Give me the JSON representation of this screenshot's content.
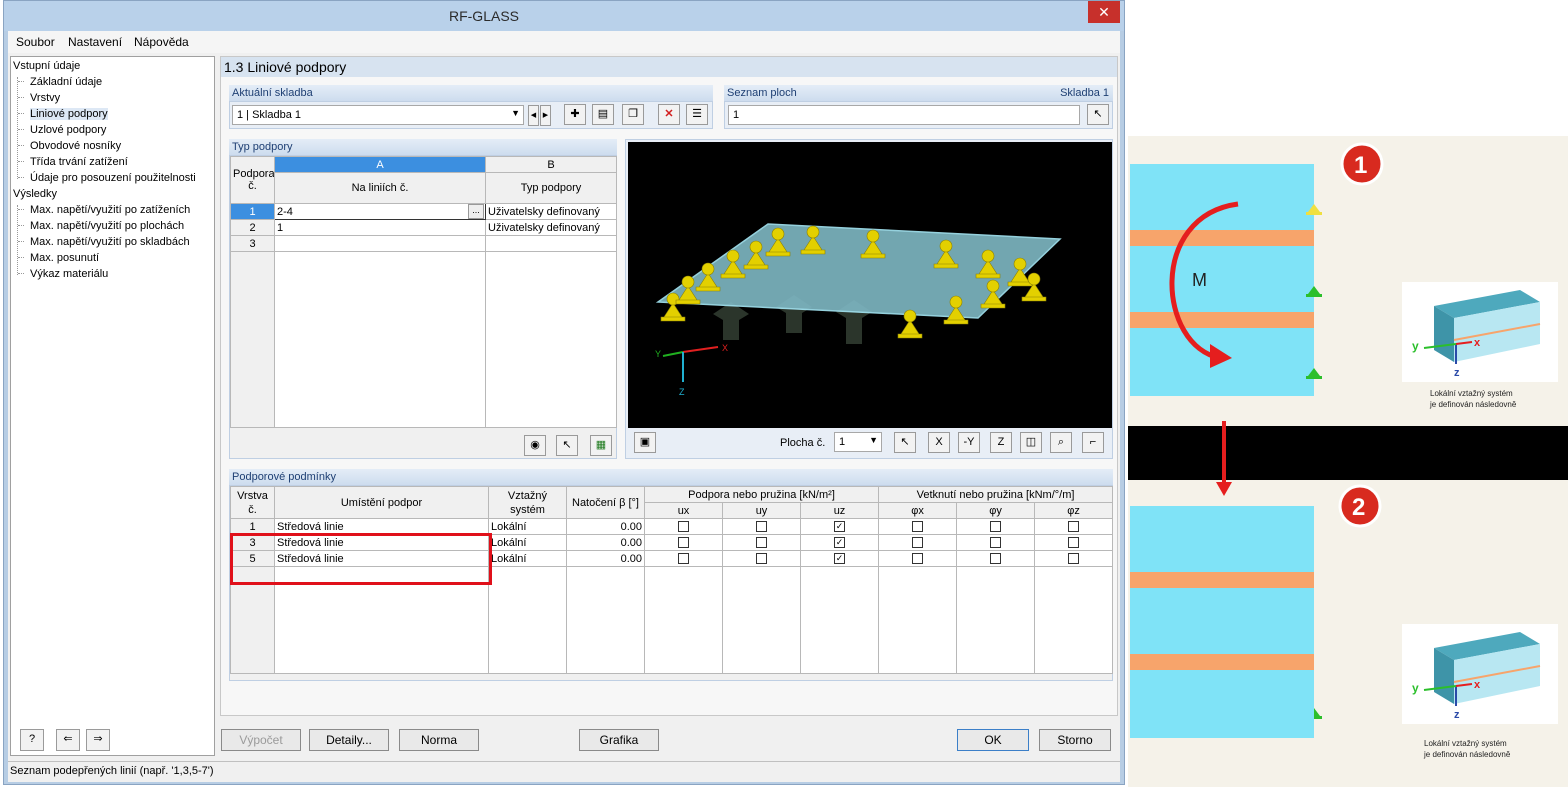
{
  "window": {
    "title": "RF-GLASS",
    "close": "✕"
  },
  "menu": [
    "Soubor",
    "Nastavení",
    "Nápověda"
  ],
  "tree": {
    "group1": "Vstupní údaje",
    "input_items": [
      "Základní údaje",
      "Vrstvy",
      "Liniové podpory",
      "Uzlové podpory",
      "Obvodové nosníky",
      "Třída trvání zatížení",
      "Údaje pro posouzení použitelnosti"
    ],
    "selected": "Liniové podpory",
    "group2": "Výsledky",
    "result_items": [
      "Max. napětí/využití po zatíženích",
      "Max. napětí/využití po plochách",
      "Max. napětí/využití po skladbách",
      "Max. posunutí",
      "Výkaz materiálu"
    ]
  },
  "page_title": "1.3 Liniové podpory",
  "current_composition": {
    "label": "Aktuální skladba",
    "value": "1 | Skladba 1"
  },
  "surface_list": {
    "label": "Seznam ploch",
    "right_label": "Skladba 1",
    "value": "1"
  },
  "support_type": {
    "label": "Typ podpory",
    "col_a": "A",
    "col_b": "B",
    "hdr_rowno": "Podpora č.",
    "hdr_a": "Na liniích č.",
    "hdr_b": "Typ podpory",
    "rows": [
      {
        "no": "1",
        "lines": "2-4",
        "type": "Uživatelsky definovaný"
      },
      {
        "no": "2",
        "lines": "1",
        "type": "Uživatelsky definovaný"
      },
      {
        "no": "3",
        "lines": "",
        "type": ""
      }
    ],
    "ellipsis": "..."
  },
  "viewport": {
    "plocha_label": "Plocha č.",
    "plocha_value": "1",
    "axis_x": "X",
    "axis_y": "Y",
    "axis_z": "Z"
  },
  "support_conditions": {
    "label": "Podporové podmínky",
    "hdr_layer": "Vrstva č.",
    "hdr_location": "Umístění podpor",
    "hdr_system": "Vztažný systém",
    "hdr_rotation": "Natočení β [°]",
    "hdr_support": "Podpora nebo pružina [kN/m²]",
    "hdr_fixity": "Vetknutí nebo pružina [kNm/°/m]",
    "sub": [
      "ux",
      "uy",
      "uz",
      "φx",
      "φy",
      "φz"
    ],
    "rows": [
      {
        "layer": "1",
        "location": "Středová linie",
        "system": "Lokální",
        "rotation": "0.00",
        "checks": [
          false,
          false,
          true,
          false,
          false,
          false
        ]
      },
      {
        "layer": "3",
        "location": "Středová linie",
        "system": "Lokální",
        "rotation": "0.00",
        "checks": [
          false,
          false,
          true,
          false,
          false,
          false
        ]
      },
      {
        "layer": "5",
        "location": "Středová linie",
        "system": "Lokální",
        "rotation": "0.00",
        "checks": [
          false,
          false,
          true,
          false,
          false,
          false
        ]
      }
    ]
  },
  "buttons": {
    "calc": "Výpočet",
    "details": "Detaily...",
    "norm": "Norma",
    "graphics": "Grafika",
    "ok": "OK",
    "cancel": "Storno"
  },
  "status": "Seznam podepřených linií (např. '1,3,5-7')",
  "illustration": {
    "badge1": "1",
    "badge2": "2",
    "moment": "M",
    "caption1_line1": "Lokální vztažný systém",
    "caption1_line2": "je definován následovně",
    "caption2_line1": "Lokální vztažný systém",
    "caption2_line2": "je definován následovně",
    "axis_y": "y",
    "axis_x": "x",
    "axis_z": "z"
  },
  "colors": {
    "accent": "#3c8fe0",
    "highlight_box": "#e0101a",
    "glass": "#7fe3f7",
    "interlayer": "#f7a46b"
  }
}
